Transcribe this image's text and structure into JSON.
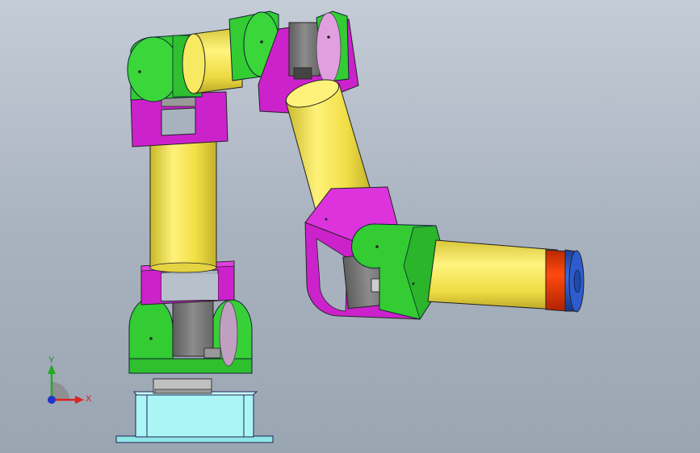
{
  "viewport": {
    "background_top": "#c4ccd6",
    "background_bottom": "#9aa5b2"
  },
  "colors": {
    "link_yellow": "#f4e65a",
    "bracket_magenta": "#cc22cc",
    "joint_green": "#33cc33",
    "servo_gray": "#7a7a7a",
    "base_cyan": "#a8f4f4",
    "end_red": "#e63300",
    "end_blue": "#2a5bd0"
  },
  "triad": {
    "x_label": "X",
    "y_label": "Y",
    "x_color": "#dd2222",
    "y_color": "#22aa22",
    "z_color": "#2233cc",
    "icon": "coordinate-triad-icon"
  }
}
